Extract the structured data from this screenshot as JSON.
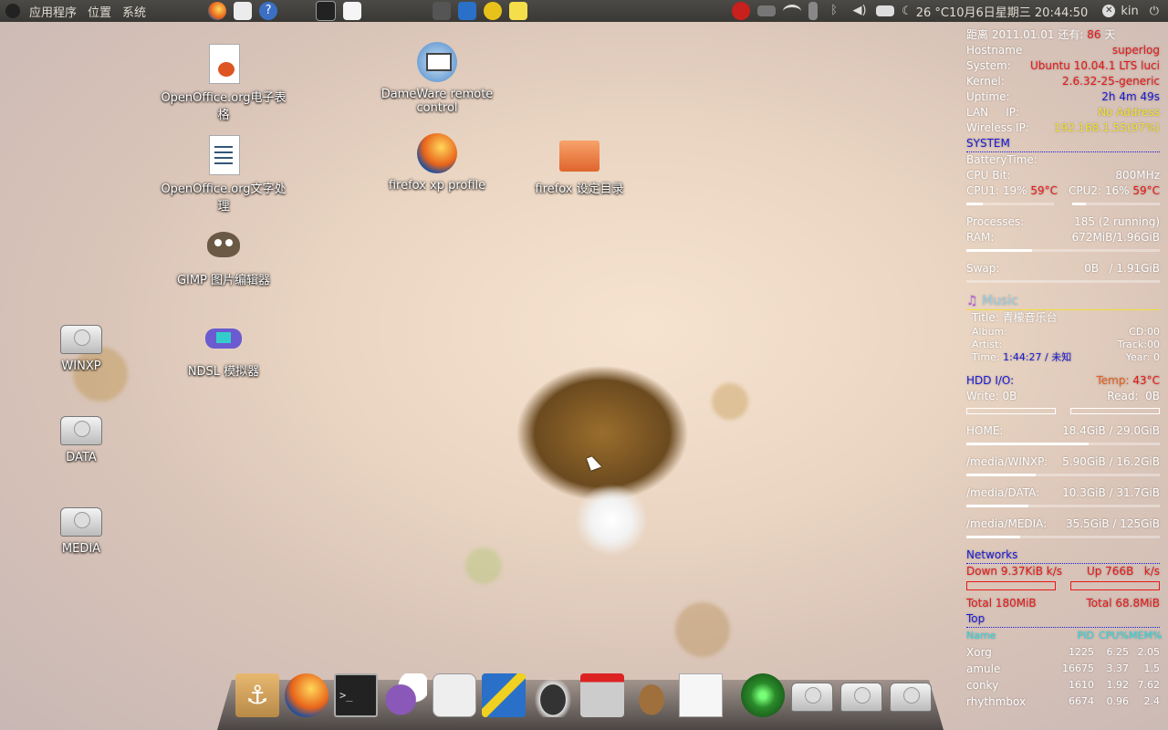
{
  "top_panel": {
    "menus": [
      "应用程序",
      "位置",
      "系统"
    ],
    "clock": "26 °C10月6日星期三 20:44:50",
    "user": "kin"
  },
  "desktop_icons": [
    {
      "label": "OpenOffice.org电子表格",
      "icon": "spreadsheet-icon"
    },
    {
      "label": "DameWare remote control",
      "icon": "monitor-icon"
    },
    {
      "label": "OpenOffice.org文字处理",
      "icon": "document-icon"
    },
    {
      "label": "firefox xp profile",
      "icon": "firefox-icon"
    },
    {
      "label": "firefox 设定目录",
      "icon": "folder-icon"
    },
    {
      "label": "GIMP 图片编辑器",
      "icon": "gimp-icon"
    },
    {
      "label": "WINXP",
      "icon": "drive-icon"
    },
    {
      "label": "NDSL 模拟器",
      "icon": "gameboy-icon"
    },
    {
      "label": "DATA",
      "icon": "drive-icon"
    },
    {
      "label": "MEDIA",
      "icon": "drive-icon"
    }
  ],
  "conky": {
    "countdown_label": "距离 2011.01.01 还有:",
    "countdown_value": "86",
    "countdown_unit": "天",
    "hostname_label": "Hostname",
    "hostname": "superlog",
    "system_label": "System:",
    "system": "Ubuntu 10.04.1 LTS luci",
    "kernel_label": "Kernel:",
    "kernel": "2.6.32-25-generic",
    "uptime_label": "Uptime:",
    "uptime": "2h 4m 49s",
    "lan_label": "LAN     IP:",
    "lan": "No Address",
    "wireless_label": "Wireless IP:",
    "wireless": "192.168.1.55(97%)",
    "system_section": "SYSTEM",
    "battery_label": "BatteryTime:",
    "cpu_bit_label": "CPU Bit:",
    "cpu_bit": "800MHz",
    "cpu1": "CPU1: 19%",
    "cpu1_temp": "59°C",
    "cpu2": "CPU2: 16%",
    "cpu2_temp": "59°C",
    "cpu1_level": 0.19,
    "cpu2_level": 0.16,
    "processes_label": "Processes:",
    "processes": "185 (2 running)",
    "ram_label": "RAM:",
    "ram": "672MiB/1.96GiB",
    "ram_level": 0.34,
    "swap_label": "Swap:",
    "swap": "0B   / 1.91GiB",
    "swap_level": 0,
    "music_section": "Music",
    "title_label": "Title:",
    "title": "青檬音乐台",
    "album_label": "Album:",
    "cd": "CD:00",
    "artist_label": "Artist:",
    "track": "Track:00",
    "time_label": "Time:",
    "time": "1:44:27 / 未知",
    "year": "Year: 0",
    "hdd_label": "HDD I/O:",
    "temp_label": "Temp:",
    "temp": "43°C",
    "write": "Write: 0B",
    "read": "Read:  0B",
    "disks": [
      {
        "label": "HOME:",
        "value": "18.4GiB / 29.0GiB",
        "level": 0.63
      },
      {
        "label": "/media/WINXP:",
        "value": "5.90GiB / 16.2GiB",
        "level": 0.36
      },
      {
        "label": "/media/DATA:",
        "value": "10.3GiB / 31.7GiB",
        "level": 0.32
      },
      {
        "label": "/media/MEDIA:",
        "value": "35.5GiB / 125GiB",
        "level": 0.28
      }
    ],
    "networks_section": "Networks",
    "down": "Down 9.37KiB k/s",
    "up": "Up 766B   k/s",
    "total_down": "Total 180MiB",
    "total_up": "Total 68.8MiB",
    "top_section": "Top",
    "top_headers": [
      "Name",
      "PID",
      "CPU%",
      "MEM%"
    ],
    "top_rows": [
      [
        "Xorg",
        "1225",
        "6.25",
        "2.05"
      ],
      [
        "amule",
        "16675",
        "3.37",
        "1.5"
      ],
      [
        "conky",
        "1610",
        "1.92",
        "7.62"
      ],
      [
        "rhythmbox",
        "6674",
        "0.96",
        "2.4"
      ]
    ]
  },
  "dock_items": [
    "anchor-icon",
    "firefox-icon",
    "terminal-icon",
    "pidgin-icon",
    "ipod-icon",
    "network-icon",
    "inkscape-icon",
    "installer-icon",
    "amule-icon",
    "text-editor-icon",
    "radar-icon",
    "drive-icon",
    "drive-icon",
    "drive-icon"
  ],
  "colors": {
    "panel": "#3f3e3a",
    "accent_red": "#e81818",
    "accent_blue": "#1b1bd8",
    "accent_cyan": "#2cd9e0",
    "accent_yellow": "#f0e030"
  }
}
